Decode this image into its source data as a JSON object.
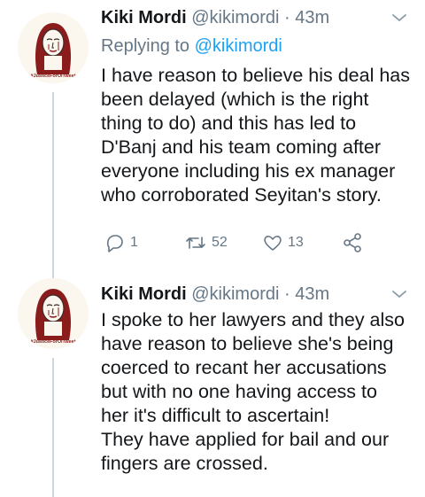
{
  "tweets": [
    {
      "display_name": "Kiki Mordi",
      "handle": "@kikimordi",
      "separator": "·",
      "time": "43m",
      "reply_prefix": "Replying to",
      "reply_handle": "@kikimordi",
      "text": "I have reason to believe his deal has\nbeen delayed (which is the right\nthing to do) and this has led to\nD'Banj and his team coming after\neveryone including his ex manager\nwho corroborated Seyitan's story.",
      "avatar_caption": "#JusticeForOlTweet",
      "actions": {
        "reply_count": "1",
        "retweet_count": "52",
        "like_count": "13"
      }
    },
    {
      "display_name": "Kiki Mordi",
      "handle": "@kikimordi",
      "separator": "·",
      "time": "43m",
      "text": "I spoke to her lawyers and they also\nhave reason to believe she's being\ncoerced to recant her accusations\nbut with no one having access to\nher it's difficult to ascertain!\nThey have applied for bail and our\nfingers are crossed.",
      "avatar_caption": "#JusticeForOlTweet"
    }
  ],
  "colors": {
    "text_primary": "#14171a",
    "text_secondary": "#657786",
    "link": "#1da1f2",
    "thread_line": "#ccd6dd",
    "avatar_red": "#8a1c1c"
  },
  "icons": [
    "chevron-down-icon",
    "reply-icon",
    "retweet-icon",
    "like-icon",
    "share-icon"
  ]
}
